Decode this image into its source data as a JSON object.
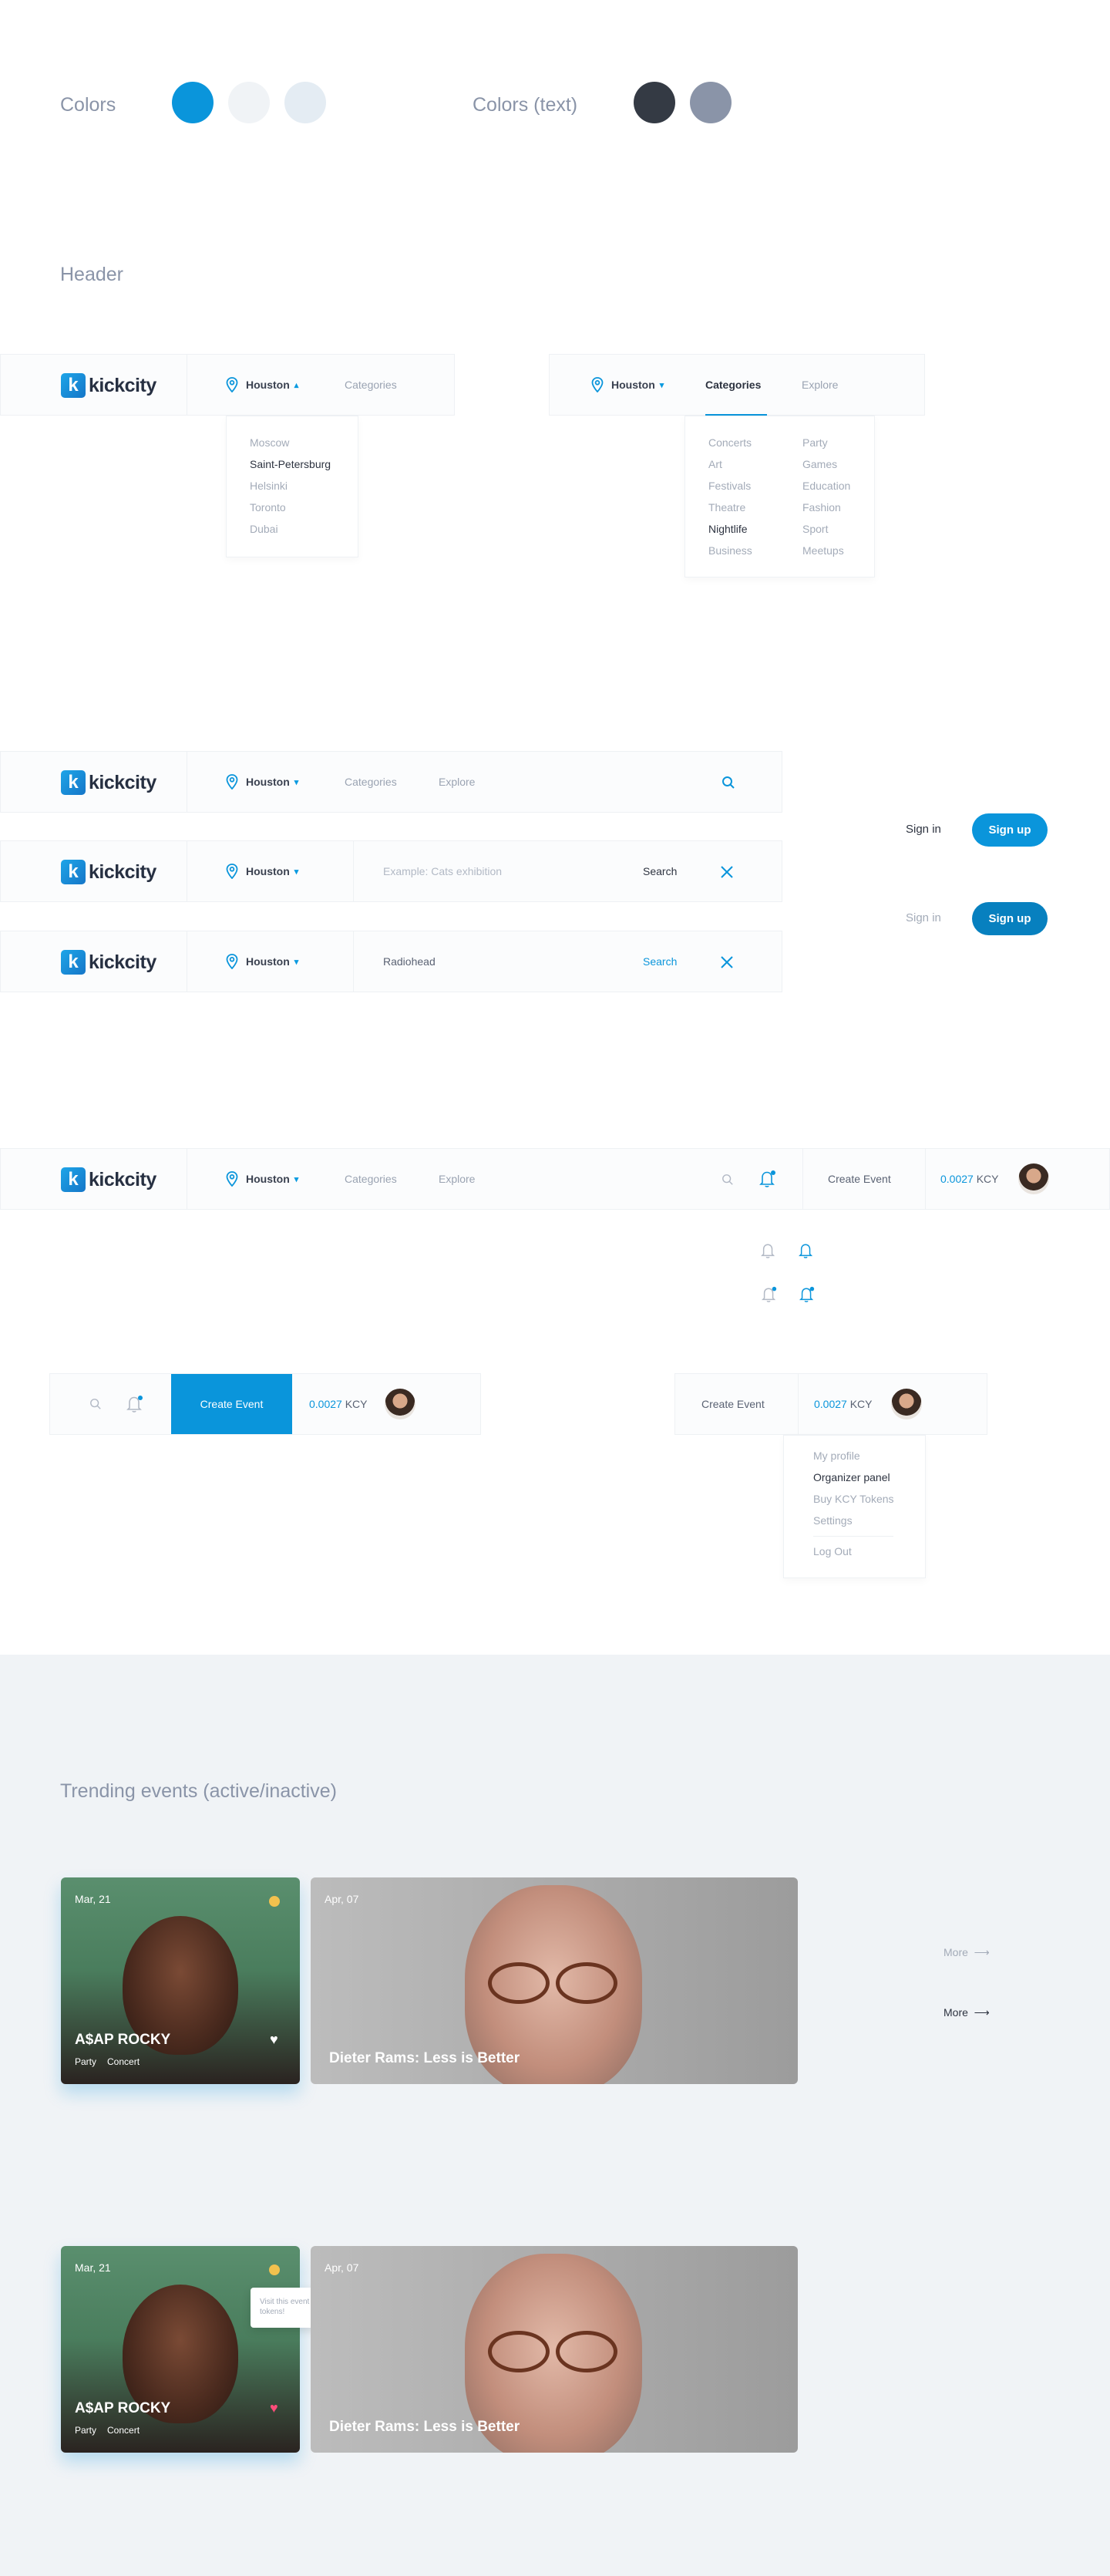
{
  "colors": {
    "label": "Colors",
    "text_label": "Colors (text)",
    "primary": "#0a95db",
    "light1": "#f0f3f6",
    "light2": "#e4ecf3",
    "text_dark": "#2d3340",
    "text_gray": "#8a94a8",
    "bg_section": "#f0f3f6"
  },
  "header": {
    "section_title": "Header",
    "logo_text": "kickcity",
    "logo_letter": "k",
    "city": "Houston",
    "categories": "Categories",
    "explore": "Explore",
    "search_placeholder": "Example: Cats exhibition",
    "search_query": "Radiohead",
    "search_label": "Search",
    "sign_in": "Sign in",
    "sign_up": "Sign up",
    "create_event": "Create Event",
    "balance_value": "0.0027",
    "balance_unit": "KCY"
  },
  "city_dropdown": [
    "Moscow",
    "Saint-Petersburg",
    "Helsinki",
    "Toronto",
    "Dubai"
  ],
  "categories_left": [
    "Concerts",
    "Art",
    "Festivals",
    "Theatre",
    "Nightlife",
    "Business"
  ],
  "categories_right": [
    "Party",
    "Games",
    "Education",
    "Fashion",
    "Sport",
    "Meetups"
  ],
  "profile_menu": [
    "My profile",
    "Organizer panel",
    "Buy KCY Tokens",
    "Settings",
    "Log Out"
  ],
  "trending": {
    "title": "Trending events (active/inactive)",
    "more": "More",
    "card1": {
      "date": "Mar, 21",
      "title": "A$AP ROCKY",
      "tags": [
        "Party",
        "Concert"
      ]
    },
    "card2": {
      "date": "Apr, 07",
      "title": "Dieter Rams: Less is Better"
    },
    "tooltip": "Visit this event and earn KCY tokens!"
  }
}
